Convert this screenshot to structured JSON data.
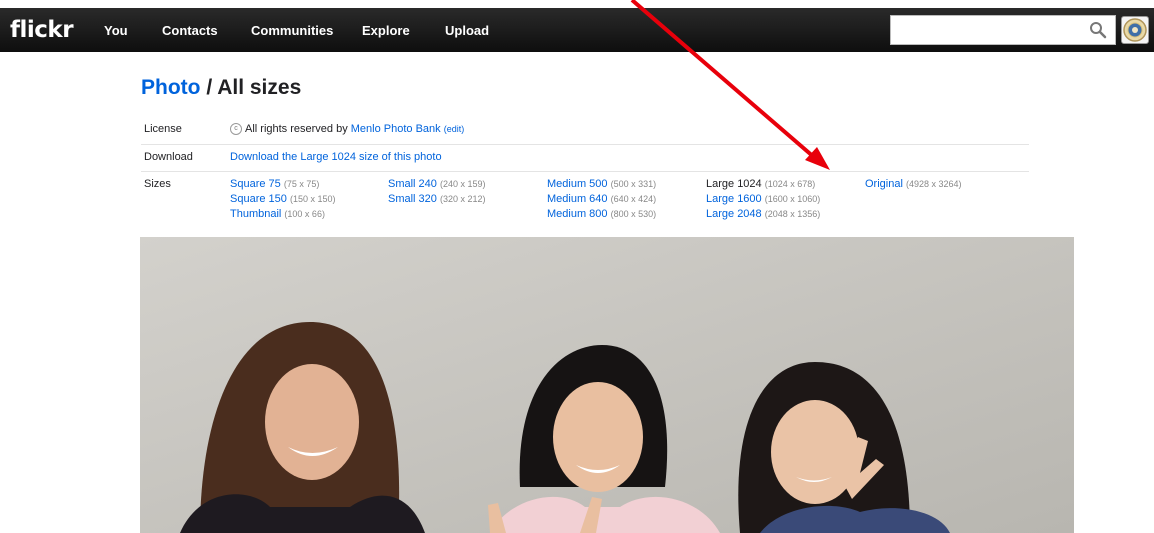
{
  "nav": {
    "logo": "flickr",
    "items": [
      "You",
      "Contacts",
      "Communities",
      "Explore",
      "Upload"
    ],
    "search": {
      "placeholder": ""
    }
  },
  "heading": {
    "link": "Photo",
    "rest": " / All sizes"
  },
  "license": {
    "label": "License",
    "copyright_symbol": "c",
    "text": "All rights reserved by ",
    "owner": "Menlo Photo Bank",
    "edit": "(edit)"
  },
  "download": {
    "label": "Download",
    "link": "Download the Large 1024 size of this photo"
  },
  "sizes": {
    "label": "Sizes",
    "columns": [
      [
        {
          "name": "Square 75",
          "dims": "(75 x 75)"
        },
        {
          "name": "Square 150",
          "dims": "(150 x 150)"
        },
        {
          "name": "Thumbnail",
          "dims": "(100 x 66)"
        }
      ],
      [
        {
          "name": "Small 240",
          "dims": "(240 x 159)"
        },
        {
          "name": "Small 320",
          "dims": "(320 x 212)"
        }
      ],
      [
        {
          "name": "Medium 500",
          "dims": "(500 x 331)"
        },
        {
          "name": "Medium 640",
          "dims": "(640 x 424)"
        },
        {
          "name": "Medium 800",
          "dims": "(800 x 530)"
        }
      ],
      [
        {
          "name": "Large 1024",
          "dims": "(1024 x 678)"
        },
        {
          "name": "Large 1600",
          "dims": "(1600 x 1060)"
        },
        {
          "name": "Large 2048",
          "dims": "(2048 x 1356)"
        }
      ],
      [
        {
          "name": "Original",
          "dims": "(4928 x 3264)"
        }
      ]
    ]
  },
  "colors": {
    "link": "#0063dc",
    "nav_bg": "#111111",
    "annotation": "#e8000b"
  },
  "icons": {
    "search": "search-icon",
    "avatar": "avatar",
    "copyright": "copyright-icon"
  }
}
